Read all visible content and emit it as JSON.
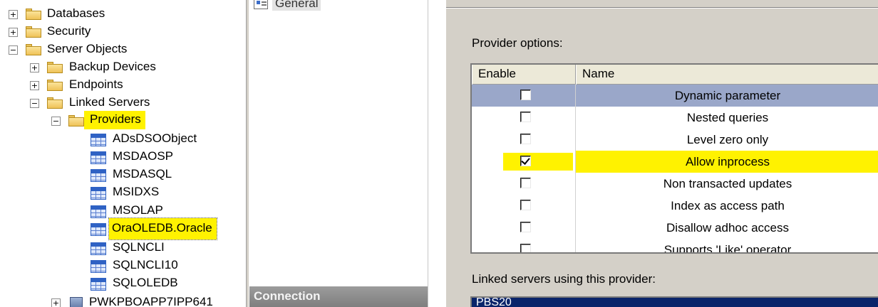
{
  "tree": {
    "items": [
      {
        "label": "Databases",
        "toggle": "+"
      },
      {
        "label": "Security",
        "toggle": "+"
      },
      {
        "label": "Server Objects",
        "toggle": "−"
      },
      {
        "label": "Backup Devices",
        "toggle": "+"
      },
      {
        "label": "Endpoints",
        "toggle": "+"
      },
      {
        "label": "Linked Servers",
        "toggle": "−"
      },
      {
        "label": "Providers",
        "toggle": "−"
      },
      {
        "label": "ADsDSOObject"
      },
      {
        "label": "MSDAOSP"
      },
      {
        "label": "MSDASQL"
      },
      {
        "label": "MSIDXS"
      },
      {
        "label": "MSOLAP"
      },
      {
        "label": "OraOLEDB.Oracle"
      },
      {
        "label": "SQLNCLI"
      },
      {
        "label": "SQLNCLI10"
      },
      {
        "label": "SQLOLEDB"
      },
      {
        "label": "PWKPBOAPP7IPP641",
        "toggle": "+"
      }
    ]
  },
  "pages": {
    "general_label": "General",
    "connection_label": "Connection"
  },
  "options": {
    "provider_options_label": "Provider options:",
    "columns": {
      "enable": "Enable",
      "name": "Name"
    },
    "rows": [
      {
        "name": "Dynamic parameter",
        "enabled": false
      },
      {
        "name": "Nested queries",
        "enabled": false
      },
      {
        "name": "Level zero only",
        "enabled": false
      },
      {
        "name": "Allow inprocess",
        "enabled": true
      },
      {
        "name": "Non transacted updates",
        "enabled": false
      },
      {
        "name": "Index as access path",
        "enabled": false
      },
      {
        "name": "Disallow adhoc access",
        "enabled": false
      },
      {
        "name": "Supports 'Like' operator",
        "enabled": false
      }
    ],
    "linked_servers_label": "Linked servers using this provider:",
    "linked_servers": [
      "PBS20"
    ]
  },
  "colors": {
    "highlight": "#fff200",
    "selected_row": "#9aa7c9",
    "list_selection": "#0a246a"
  }
}
